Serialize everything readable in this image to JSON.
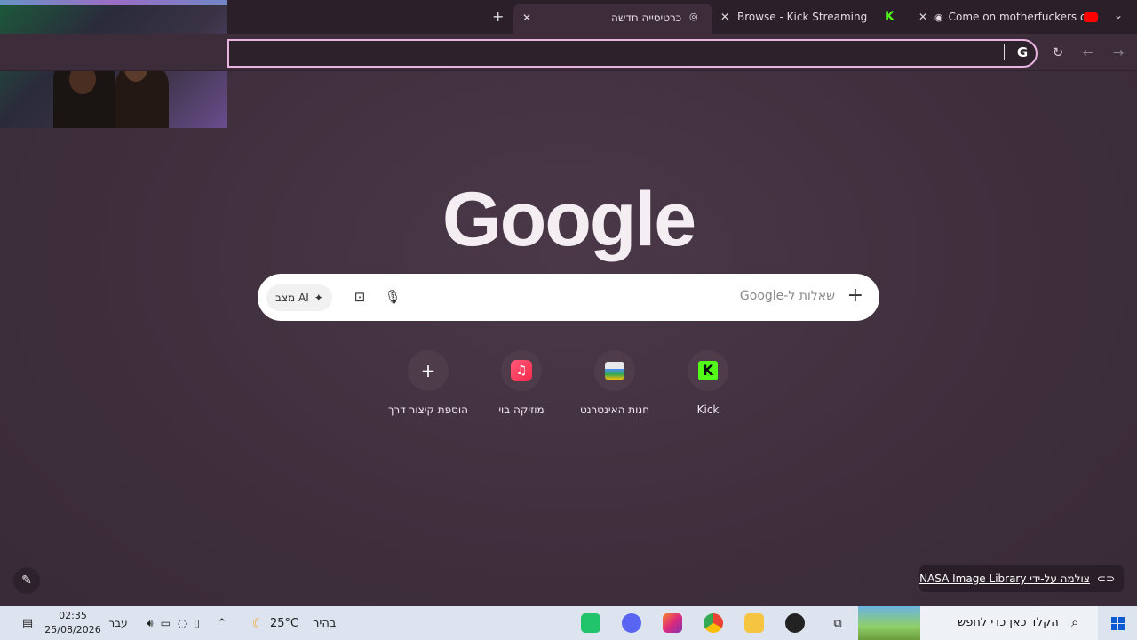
{
  "tabs": [
    {
      "label": "Come on motherfuckers co",
      "favicon": "youtube-icon"
    },
    {
      "label": "Browse - Kick Streaming",
      "favicon": "kick-icon"
    },
    {
      "label": "כרטיסייה חדשה",
      "favicon": "chrome-icon",
      "active": true
    }
  ],
  "toolbar": {
    "back": "←",
    "forward": "→",
    "reload": "↻",
    "omni_g": "G"
  },
  "logo": "Google",
  "search": {
    "placeholder": "שאלות ל-Google",
    "ai_mode": "מצב AI",
    "plus": "+"
  },
  "shortcuts": [
    {
      "label": "Kick",
      "icon": "kick-icon",
      "glyph": "K"
    },
    {
      "label": "חנות האינטרנט",
      "icon": "web-store-icon"
    },
    {
      "label": "מוזיקה בוי",
      "icon": "music-icon",
      "glyph": "♫"
    },
    {
      "label": "הוספת קיצור דרך",
      "icon": "add-icon",
      "glyph": "+"
    }
  ],
  "credit": {
    "text": "צולמה על-ידי NASA Image Library"
  },
  "taskbar": {
    "search_placeholder": "הקלד כאן כדי לחפש",
    "weather_temp": "25°C",
    "weather_text": "בהיר",
    "lang": "עבר",
    "time": "02:35",
    "date": "25/08/2026"
  },
  "colors": {
    "accent": "#e9b3df",
    "kick_green": "#53fc18",
    "background": "#3f2f3d"
  }
}
